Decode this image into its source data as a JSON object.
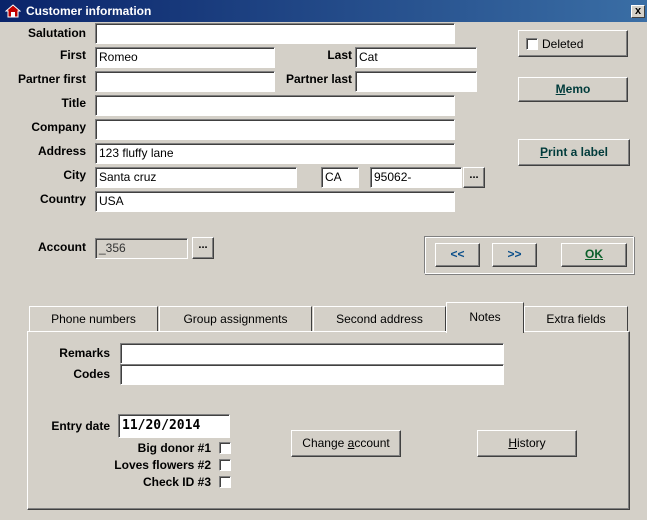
{
  "window": {
    "title": "Customer information",
    "close_label": "x"
  },
  "labels": {
    "salutation": "Salutation",
    "first": "First",
    "last": "Last",
    "partner_first": "Partner first",
    "partner_last": "Partner last",
    "title": "Title",
    "company": "Company",
    "address": "Address",
    "city": "City",
    "country": "Country",
    "account": "Account"
  },
  "fields": {
    "salutation": "",
    "first": "Romeo",
    "last": "Cat",
    "partner_first": "",
    "partner_last": "",
    "title": "",
    "company": "",
    "address": "123 fluffy lane",
    "city": "Santa cruz",
    "state": "CA",
    "zip": "95062-",
    "country": "USA",
    "account": "_356"
  },
  "buttons": {
    "ellipsis": "...",
    "deleted_label": "Deleted",
    "memo_underlined": "M",
    "memo_rest": "emo",
    "print_underlined": "P",
    "print_rest": "rint a label",
    "prev": "<<",
    "next": ">>",
    "ok": "OK"
  },
  "tabs": [
    {
      "label": "Phone numbers",
      "active": false
    },
    {
      "label": "Group assignments",
      "active": false
    },
    {
      "label": "Second address",
      "active": false
    },
    {
      "label": "Notes",
      "active": true
    },
    {
      "label": "Extra fields",
      "active": false
    }
  ],
  "notes": {
    "remarks_label": "Remarks",
    "remarks_value": "",
    "codes_label": "Codes",
    "codes_value": "",
    "entry_date_label": "Entry date",
    "entry_date_value": "11/20/2014",
    "checkboxes": [
      {
        "label": "Big donor #1",
        "checked": false
      },
      {
        "label": "Loves flowers #2",
        "checked": false
      },
      {
        "label": "Check ID #3",
        "checked": false
      }
    ],
    "change_account_prefix": "Change ",
    "change_account_underlined": "a",
    "change_account_suffix": "ccount",
    "history_underlined": "H",
    "history_rest": "istory"
  }
}
